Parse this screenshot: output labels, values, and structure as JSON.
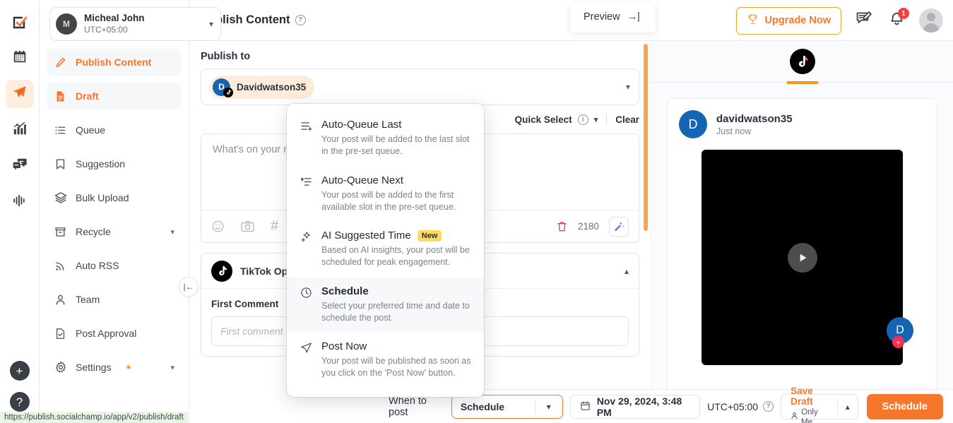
{
  "rail": {
    "items": [
      {
        "name": "calendar-icon",
        "label": "Calendar",
        "active": false
      },
      {
        "name": "publish-icon",
        "label": "Publish",
        "active": true
      },
      {
        "name": "analytics-icon",
        "label": "Analytics",
        "active": false
      },
      {
        "name": "engage-icon",
        "label": "Engage",
        "active": false
      },
      {
        "name": "monitor-icon",
        "label": "Monitor",
        "active": false
      }
    ],
    "add_label": "+",
    "help_label": "?"
  },
  "account": {
    "avatar_initial": "M",
    "name": "Micheal John",
    "timezone": "UTC+05:00"
  },
  "sidebar": {
    "items": [
      {
        "label": "Publish Content",
        "icon": "pencil-icon",
        "active": true,
        "chevron": false
      },
      {
        "label": "Draft",
        "icon": "document-icon",
        "active": true,
        "chevron": false
      },
      {
        "label": "Queue",
        "icon": "list-icon",
        "active": false,
        "chevron": false
      },
      {
        "label": "Suggestion",
        "icon": "bookmark-icon",
        "active": false,
        "chevron": false
      },
      {
        "label": "Bulk Upload",
        "icon": "layers-icon",
        "active": false,
        "chevron": false
      },
      {
        "label": "Recycle",
        "icon": "archive-icon",
        "active": false,
        "chevron": true
      },
      {
        "label": "Auto RSS",
        "icon": "rss-icon",
        "active": false,
        "chevron": false
      },
      {
        "label": "Team",
        "icon": "user-icon",
        "active": false,
        "chevron": false
      },
      {
        "label": "Post Approval",
        "icon": "approval-icon",
        "active": false,
        "chevron": false
      },
      {
        "label": "Settings",
        "icon": "gear-icon",
        "active": false,
        "chevron": true,
        "dot": true
      }
    ],
    "collapse_label": "|←"
  },
  "header": {
    "title": "Publish Content",
    "help": "?",
    "upgrade_label": "Upgrade Now",
    "notification_count": "1",
    "preview_label": "Preview",
    "preview_arrow": "→|"
  },
  "composer": {
    "publish_to_label": "Publish to",
    "selected_account": "Davidwatson35",
    "selected_account_initial": "D",
    "quick_select_label": "Quick Select",
    "clear_label": "Clear",
    "editor_placeholder": "What's on your mind?",
    "char_count": "2180",
    "tiktok_options_label": "TikTok Options",
    "first_comment_label": "First Comment",
    "first_comment_placeholder": "First comment"
  },
  "preview": {
    "tab": "tiktok",
    "username": "davidwatson35",
    "avatar_initial": "D",
    "time": "Just now",
    "side_avatar_initial": "D",
    "follow_label": "+"
  },
  "schedule_menu": {
    "items": [
      {
        "title": "Auto-Queue Last",
        "desc": "Your post will be added to the last slot in the pre-set queue.",
        "icon": "queue-last-icon",
        "selected": false,
        "badge": null
      },
      {
        "title": "Auto-Queue Next",
        "desc": "Your post will be added to the first available slot in the pre-set queue.",
        "icon": "queue-next-icon",
        "selected": false,
        "badge": null
      },
      {
        "title": "AI Suggested Time",
        "desc": "Based on AI insights, your post will be scheduled for peak engagement.",
        "icon": "sparkle-icon",
        "selected": false,
        "badge": "New"
      },
      {
        "title": "Schedule",
        "desc": "Select your preferred time and date to schedule the post.",
        "icon": "clock-icon",
        "selected": true,
        "badge": null
      },
      {
        "title": "Post Now",
        "desc": "Your post will be published as soon as you click on the 'Post Now' button.",
        "icon": "send-icon",
        "selected": false,
        "badge": null
      }
    ]
  },
  "bottom_bar": {
    "when_label": "When to post",
    "when_value": "Schedule",
    "date_value": "Nov 29, 2024, 3:48 PM",
    "timezone": "UTC+05:00",
    "timezone_help": "?",
    "save_draft_label": "Save Draft",
    "save_draft_sub": "Only Me",
    "schedule_button": "Schedule"
  },
  "status_bar": {
    "url": "https://publish.socialchamp.io/app/v2/publish/draft"
  },
  "colors": {
    "accent": "#f6762c",
    "accent_light": "#f7941d",
    "badge_yellow": "#fbda5c",
    "danger": "#f43f3f",
    "tiktok_pink": "#fe2c55",
    "avatar_blue": "#1565b5"
  }
}
